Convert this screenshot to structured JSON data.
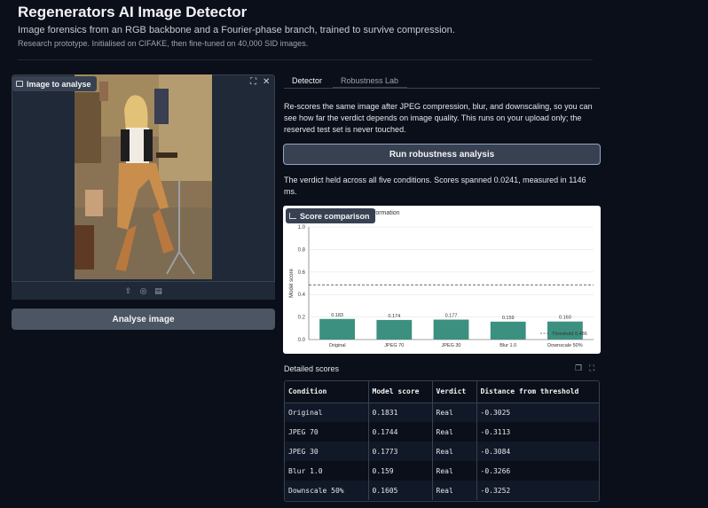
{
  "header": {
    "title": "Regenerators AI Image Detector",
    "subtitle": "Image forensics from an RGB backbone and a Fourier-phase branch, trained to survive compression.",
    "note": "Research prototype. Initialised on CIFAKE, then fine-tuned on 40,000 SID images."
  },
  "left": {
    "image_label": "Image to analyse",
    "analyse_label": "Analyse image"
  },
  "tabs": [
    {
      "label": "Detector",
      "active": false
    },
    {
      "label": "Robustness Lab",
      "active": true
    }
  ],
  "robustness": {
    "description": "Re-scores the same image after JPEG compression, blur, and downscaling, so you can see how far the verdict depends on image quality. This runs on your upload only; the reserved test set is never touched.",
    "run_label": "Run robustness analysis",
    "verdict_text": "The verdict held across all five conditions. Scores spanned 0.0241, measured in 1146 ms.",
    "chart_label": "Score comparison",
    "chart_title_fragment": "nsformation",
    "detailed_label": "Detailed scores"
  },
  "chart_data": {
    "type": "bar",
    "categories": [
      "Original",
      "JPEG 70",
      "JPEG 30",
      "Blur 1.0",
      "Downscale 50%"
    ],
    "values": [
      0.183,
      0.174,
      0.177,
      0.159,
      0.16
    ],
    "value_labels": [
      "0.183",
      "0.174",
      "0.177",
      "0.159",
      "0.160"
    ],
    "ylabel": "Model score",
    "ylim": [
      0,
      1.0
    ],
    "yticks": [
      "0.0",
      "0.2",
      "0.4",
      "0.6",
      "0.8",
      "1.0"
    ],
    "threshold": 0.4856,
    "threshold_label": "Threshold 0.486",
    "bar_color": "#3c9080",
    "threshold_style": "dashed"
  },
  "table": {
    "headers": [
      "Condition",
      "Model score",
      "Verdict",
      "Distance from threshold"
    ],
    "rows": [
      [
        "Original",
        "0.1831",
        "Real",
        "-0.3025"
      ],
      [
        "JPEG 70",
        "0.1744",
        "Real",
        "-0.3113"
      ],
      [
        "JPEG 30",
        "0.1773",
        "Real",
        "-0.3084"
      ],
      [
        "Blur 1.0",
        "0.159",
        "Real",
        "-0.3266"
      ],
      [
        "Downscale 50%",
        "0.1605",
        "Real",
        "-0.3252"
      ]
    ]
  },
  "colors": {
    "background": "#0b0f19",
    "panel": "#1f2937",
    "button": "#4b5563",
    "accent_border": "#93a4c9",
    "bar": "#3c9080"
  },
  "icons": [
    "image-icon",
    "fullscreen-icon",
    "close-icon",
    "upload-icon",
    "webcam-icon",
    "clipboard-icon",
    "chart-icon",
    "copy-icon",
    "expand-icon"
  ]
}
